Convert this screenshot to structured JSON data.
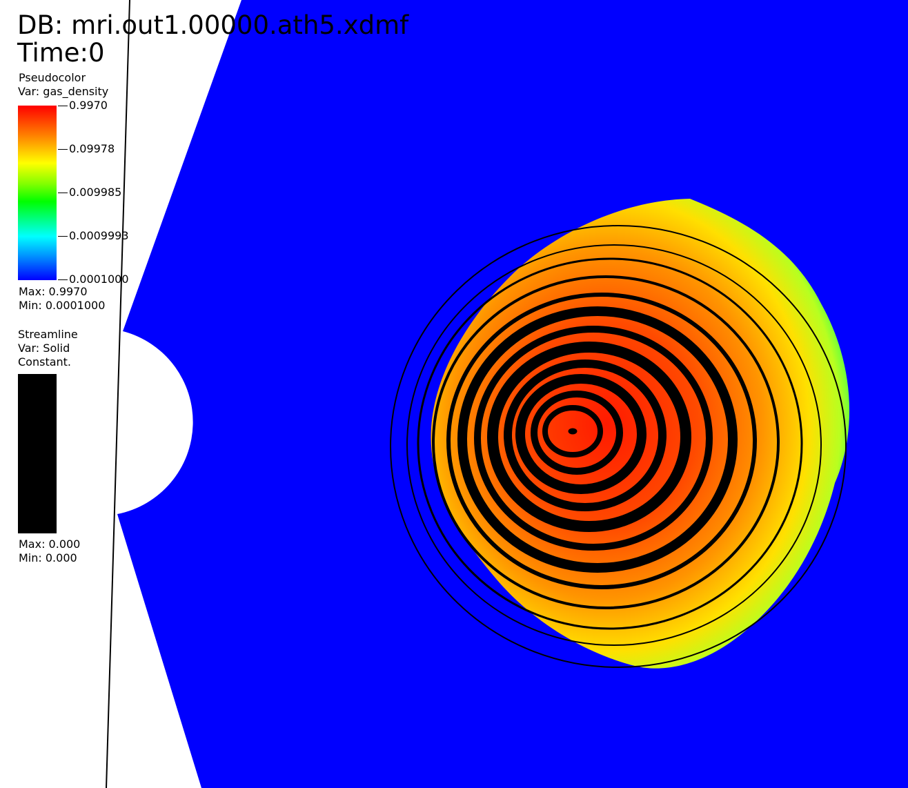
{
  "header": {
    "db_label": "DB: mri.out1.00000.ath5.xdmf",
    "time_label": "Time:0"
  },
  "pseudocolor_legend": {
    "plot_type": "Pseudocolor",
    "var": "Var: gas_density",
    "ticks": [
      "0.9970",
      "0.09978",
      "0.009985",
      "0.0009993",
      "0.0001000"
    ],
    "max": "Max:  0.9970",
    "min": "Min:  0.0001000"
  },
  "streamline_legend": {
    "plot_type": "Streamline",
    "var": "Var: Solid",
    "mode": "Constant.",
    "max": "Max:  0.000",
    "min": "Min:  0.000"
  },
  "colors": {
    "background_domain": "#0000ff",
    "colormap": [
      "#ff0000",
      "#ff8000",
      "#ffff00",
      "#80ff00",
      "#00ff00",
      "#00ffff",
      "#0080ff",
      "#0000ff"
    ],
    "streamline": "#000000"
  }
}
